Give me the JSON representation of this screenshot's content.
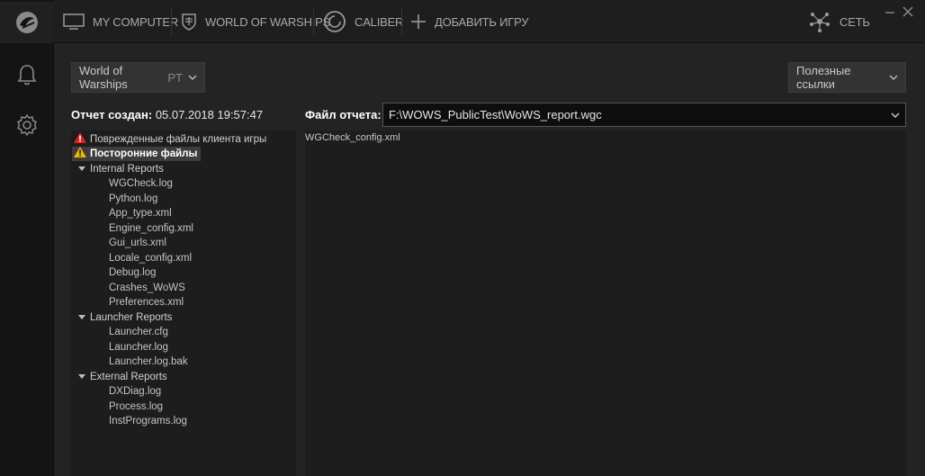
{
  "topbar": {
    "tabs": [
      {
        "label": "MY COMPUTER",
        "icon": "monitor-icon"
      },
      {
        "label": "WORLD OF WARSHIPS",
        "icon": "warships-emblem-icon"
      },
      {
        "label": "CALIBER",
        "icon": "caliber-icon"
      },
      {
        "label": "ДОБАВИТЬ ИГРУ",
        "icon": "plus-icon"
      }
    ],
    "network_label": "СЕТЬ"
  },
  "rail": {
    "icons": [
      "wargaming-logo-icon",
      "bell-icon",
      "gear-icon"
    ]
  },
  "game_select": {
    "label": "World of Warships",
    "sub": "PT"
  },
  "links_select": {
    "label": "Полезные ссылки"
  },
  "report": {
    "created_label": "Отчет создан:",
    "created_value": "05.07.2018 19:57:47",
    "file_label": "Файл отчета:",
    "file_value": "F:\\WOWS_PublicTest\\WoWS_report.wgc"
  },
  "tree": {
    "errors_label": "Поврежденные файлы клиента игры",
    "foreign_label": "Посторонние файлы",
    "groups": [
      {
        "label": "Internal Reports",
        "items": [
          "WGCheck.log",
          "Python.log",
          "App_type.xml",
          "Engine_config.xml",
          "Gui_urls.xml",
          "Locale_config.xml",
          "Debug.log",
          "Crashes_WoWS",
          "Preferences.xml"
        ]
      },
      {
        "label": "Launcher Reports",
        "items": [
          "Launcher.cfg",
          "Launcher.log",
          "Launcher.log.bak"
        ]
      },
      {
        "label": "External Reports",
        "items": [
          "DXDiag.log",
          "Process.log",
          "InstPrograms.log"
        ]
      }
    ]
  },
  "content": {
    "items": [
      "WGCheck_config.xml"
    ]
  },
  "colors": {
    "error_red": "#e02020",
    "warning_yellow": "#f0b400",
    "accent_white": "#ffffff"
  }
}
